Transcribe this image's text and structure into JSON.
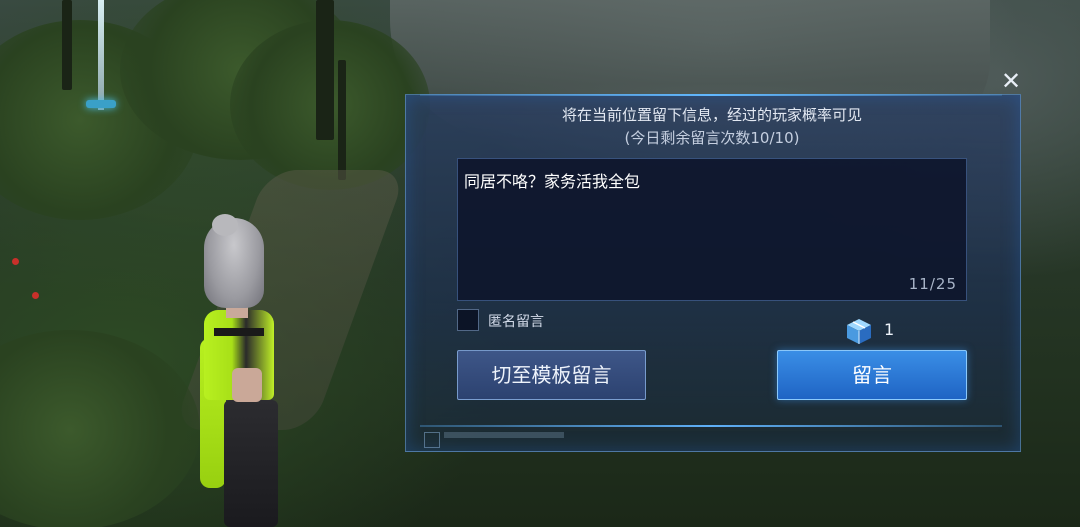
{
  "dialog": {
    "info_line": "将在当前位置留下信息，经过的玩家概率可见",
    "remaining_line": "(今日剩余留言次数10/10)",
    "message_text": "同居不咯？家务活我全包",
    "char_count": "11/25",
    "anonymous_label": "匿名留言",
    "item_count": "1",
    "template_button": "切至模板留言",
    "submit_button": "留言",
    "close_symbol": "✕"
  },
  "icons": {
    "close": "close-icon",
    "item": "gift-box-icon"
  },
  "colors": {
    "accent": "#2f7fd8",
    "panel": "#22365c",
    "text": "#e2e8f2"
  }
}
